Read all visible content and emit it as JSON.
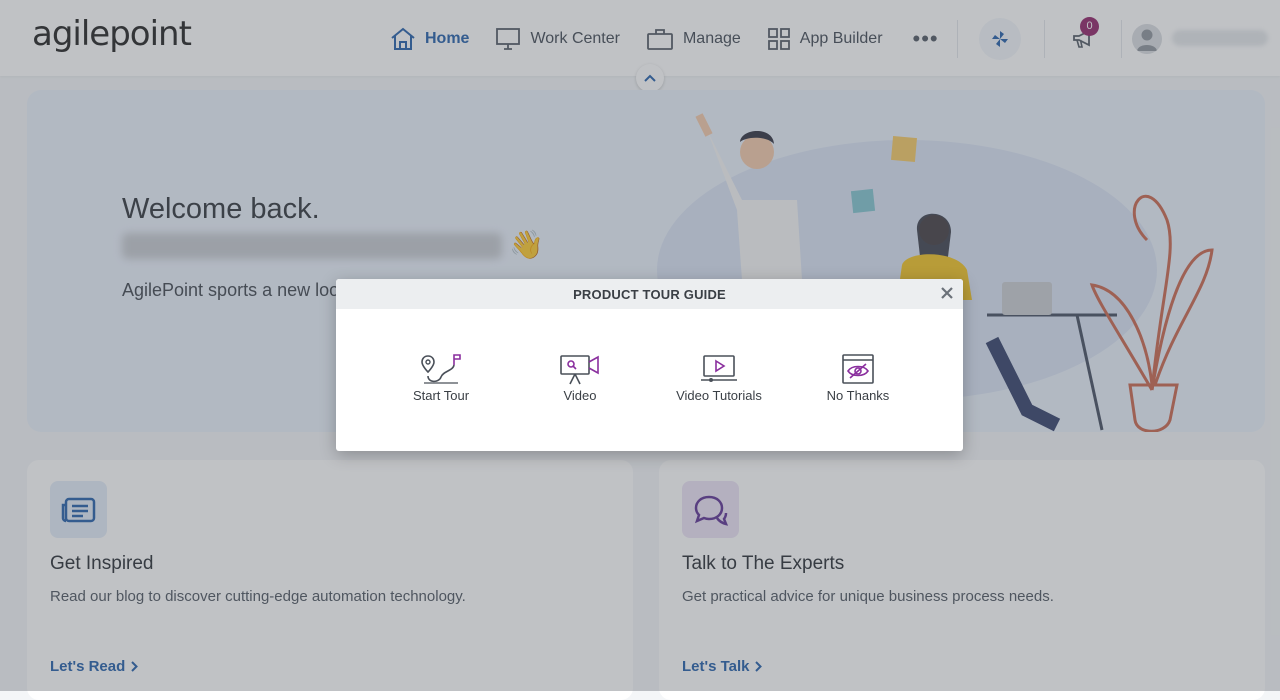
{
  "header": {
    "logo_text": "agilepoint",
    "nav": [
      {
        "label": "Home",
        "icon": "home-icon"
      },
      {
        "label": "Work Center",
        "icon": "monitor-icon"
      },
      {
        "label": "Manage",
        "icon": "briefcase-icon"
      },
      {
        "label": "App Builder",
        "icon": "grid-icon"
      }
    ],
    "more_label": "•••",
    "notification_count": "0",
    "accent_color": "#1e5ba8",
    "badge_color": "#8e1c64"
  },
  "hero": {
    "welcome": "Welcome back.",
    "wave_emoji": "👋",
    "text": "AgilePoint sports a new look capabilities to maximize you"
  },
  "cards": [
    {
      "title": "Get Inspired",
      "description": "Read our blog to discover cutting-edge automation technology.",
      "link": "Let's Read"
    },
    {
      "title": "Talk to The Experts",
      "description": "Get practical advice for unique business process needs.",
      "link": "Let's Talk"
    }
  ],
  "modal": {
    "title": "PRODUCT TOUR GUIDE",
    "options": [
      {
        "label": "Start Tour",
        "icon": "route-map-icon"
      },
      {
        "label": "Video",
        "icon": "video-camera-icon"
      },
      {
        "label": "Video Tutorials",
        "icon": "play-screen-icon"
      },
      {
        "label": "No Thanks",
        "icon": "hidden-eye-icon"
      }
    ]
  }
}
